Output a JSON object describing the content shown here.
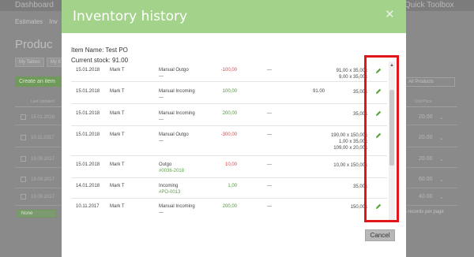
{
  "background": {
    "dashboard": "Dashboard",
    "toolbox": "Quick Toolbox",
    "nav": [
      "Estimates",
      "Inv"
    ],
    "page_title": "Produc",
    "tabs": [
      "My Tables",
      "My It"
    ],
    "create_button": "Create an item",
    "filter": "All Products",
    "thead_left": "Last Updated",
    "thead_right": "Unit Price",
    "rows": [
      {
        "date": "15.01.2018",
        "price": "20.00"
      },
      {
        "date": "10.11.2017",
        "price": "20.00"
      },
      {
        "date": "19.09.2017",
        "price": "20.00"
      },
      {
        "date": "19.09.2017",
        "price": "60.00"
      },
      {
        "date": "19.09.2017",
        "price": "40.00"
      }
    ],
    "none_label": "None",
    "records": "25 records per page"
  },
  "modal": {
    "title": "Inventory history",
    "close_glyph": "✕",
    "item_name_label": "Item Name:",
    "item_name": "Test PO",
    "current_stock_label": "Current stock:",
    "current_stock": "91.00",
    "cancel_label": "Cancel",
    "rows": [
      {
        "date": "15.01.2018",
        "user": "Mark T",
        "type": "Manual Outgo",
        "sub": "---",
        "qty": "-100,00",
        "qty_sign": "neg",
        "stock": "---",
        "stock2": "",
        "dims": [
          "91,00 x 35,00c",
          "9,00 x 35,00c"
        ],
        "editable": true
      },
      {
        "date": "15.01.2018",
        "user": "Mark T",
        "type": "Manual Incoming",
        "sub": "---",
        "qty": "100,00",
        "qty_sign": "pos",
        "stock": "91.00",
        "stock2": "",
        "dims": [
          "35,00c"
        ],
        "editable": true
      },
      {
        "date": "15.01.2018",
        "user": "Mark T",
        "type": "Manual Incoming",
        "sub": "---",
        "qty": "200,00",
        "qty_sign": "pos",
        "stock": "---",
        "stock2": "",
        "dims": [
          "35,00c"
        ],
        "editable": true
      },
      {
        "date": "15.01.2018",
        "user": "Mark T",
        "type": "Manual Outgo",
        "sub": "---",
        "qty": "-300,00",
        "qty_sign": "neg",
        "stock": "---",
        "stock2": "",
        "dims": [
          "190,00 x 150,00c",
          "1,00 x 35,00c",
          "109,00 x 20,00c"
        ],
        "editable": true
      },
      {
        "date": "15.01.2018",
        "user": "Mark T",
        "type": "Outgo",
        "sub": "#0036-2018",
        "qty": "10,00",
        "qty_sign": "neg",
        "stock": "---",
        "stock2": "",
        "dims": [
          "10,00 x 150,00c"
        ],
        "editable": false
      },
      {
        "date": "14.01.2018",
        "user": "Mark T",
        "type": "Incoming",
        "sub": "#PO-0013",
        "qty": "1,00",
        "qty_sign": "pos",
        "stock": "---",
        "stock2": "",
        "dims": [
          "35,00c"
        ],
        "editable": false
      },
      {
        "date": "10.11.2017",
        "user": "Mark T",
        "type": "Manual Incoming",
        "sub": "---",
        "qty": "200,00",
        "qty_sign": "pos",
        "stock": "---",
        "stock2": "",
        "dims": [
          "150,00c"
        ],
        "editable": true
      }
    ]
  },
  "colors": {
    "header_green": "#a3d28a",
    "negative": "#e04545",
    "positive": "#4a9d2f",
    "link_green": "#5aa53f",
    "highlight": "#e1161b"
  },
  "icons": {
    "edit": "pencil-icon",
    "close": "close-icon",
    "scroll_up": "chevron-up-icon"
  }
}
